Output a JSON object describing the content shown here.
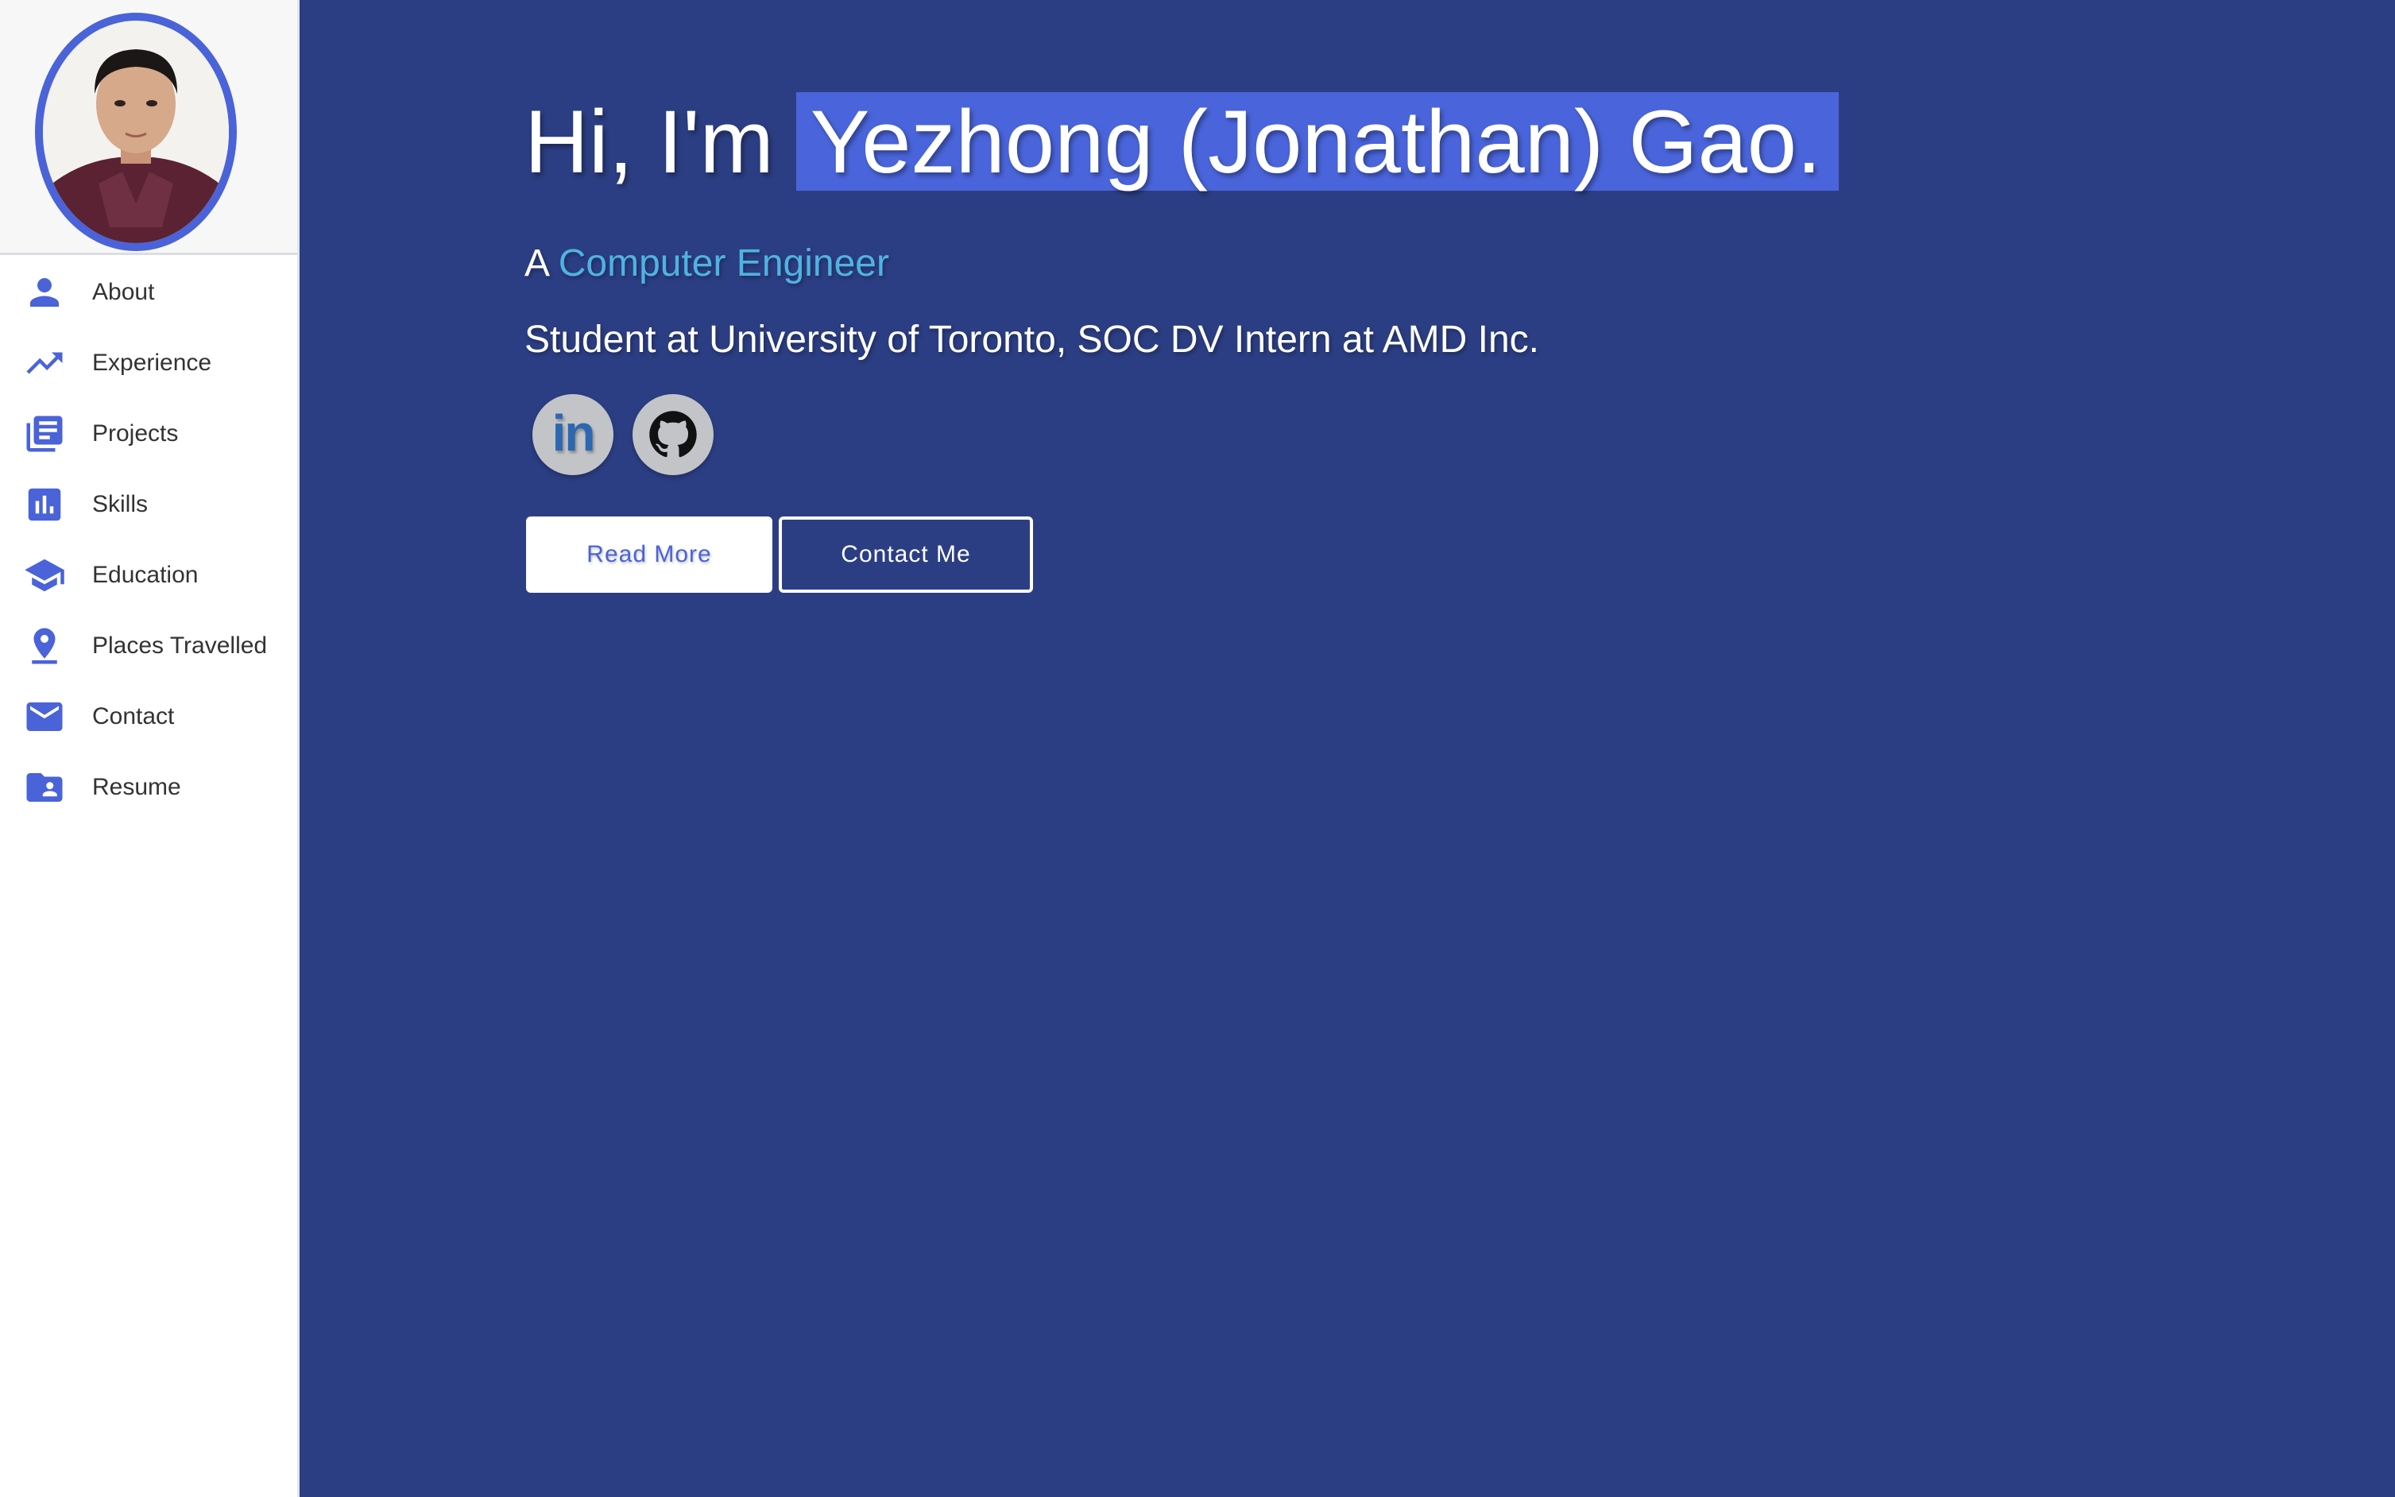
{
  "sidebar": {
    "items": [
      {
        "label": "About",
        "icon": "person-icon"
      },
      {
        "label": "Experience",
        "icon": "trending-up-icon"
      },
      {
        "label": "Projects",
        "icon": "library-books-icon"
      },
      {
        "label": "Skills",
        "icon": "bar-chart-icon"
      },
      {
        "label": "Education",
        "icon": "graduation-cap-icon"
      },
      {
        "label": "Places Travelled",
        "icon": "location-pin-icon"
      },
      {
        "label": "Contact",
        "icon": "mail-icon"
      },
      {
        "label": "Resume",
        "icon": "folder-user-icon"
      }
    ]
  },
  "hero": {
    "greeting_prefix": "Hi, I'm",
    "name": "Yezhong (Jonathan) Gao.",
    "role_prefix": "A",
    "role": "Computer Engineer",
    "subtitle": "Student at University of Toronto, SOC DV Intern at AMD Inc.",
    "linkedin_text": "in",
    "read_more_label": "Read More",
    "contact_label": "Contact Me"
  },
  "colors": {
    "accent": "#4a63d8",
    "background": "#2c3e83",
    "role_highlight": "#4fb3e0"
  }
}
